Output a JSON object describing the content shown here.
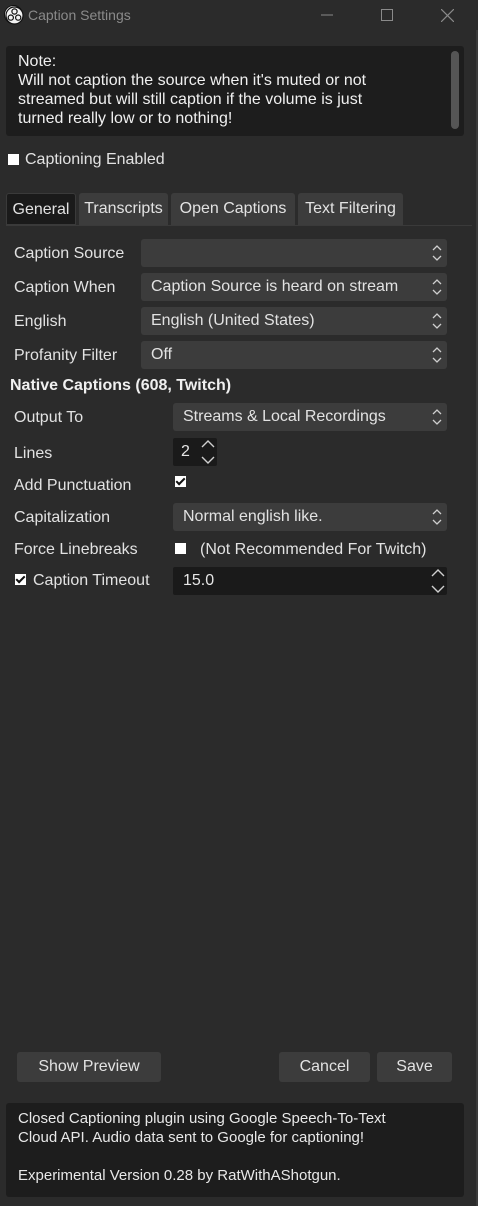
{
  "window": {
    "title": "Caption Settings",
    "icon": "obs-logo-icon"
  },
  "note": {
    "lines": [
      "Note:",
      "Will not caption the source when it's muted or not",
      "streamed but will still caption if the volume is just",
      "turned really low or to nothing!"
    ]
  },
  "captioning_enabled": {
    "label": "Captioning Enabled",
    "checked": false
  },
  "tabs": [
    {
      "label": "General",
      "active": true
    },
    {
      "label": "Transcripts",
      "active": false
    },
    {
      "label": "Open Captions",
      "active": false
    },
    {
      "label": "Text Filtering",
      "active": false
    }
  ],
  "general": {
    "caption_source": {
      "label": "Caption Source",
      "value": ""
    },
    "caption_when": {
      "label": "Caption When",
      "value": "Caption Source is heard on stream"
    },
    "language": {
      "label": "English",
      "value": "English (United States)"
    },
    "profanity_filter": {
      "label": "Profanity Filter",
      "value": "Off"
    }
  },
  "native_captions": {
    "heading": "Native Captions (608, Twitch)",
    "output_to": {
      "label": "Output To",
      "value": "Streams & Local Recordings"
    },
    "lines": {
      "label": "Lines",
      "value": "2"
    },
    "add_punctuation": {
      "label": "Add Punctuation",
      "checked": true
    },
    "capitalization": {
      "label": "Capitalization",
      "value": "Normal english like."
    },
    "force_linebreaks": {
      "label": "Force Linebreaks",
      "checked": false,
      "note": "(Not Recommended For Twitch)"
    },
    "caption_timeout": {
      "label": "Caption Timeout",
      "checked": true,
      "value": "15.0"
    }
  },
  "buttons": {
    "show_preview": "Show Preview",
    "cancel": "Cancel",
    "save": "Save"
  },
  "footer": {
    "lines": [
      "Closed Captioning plugin using Google Speech-To-Text",
      "Cloud API. Audio data sent to Google for captioning!",
      "",
      "Experimental Version 0.28 by RatWithAShotgun."
    ]
  }
}
